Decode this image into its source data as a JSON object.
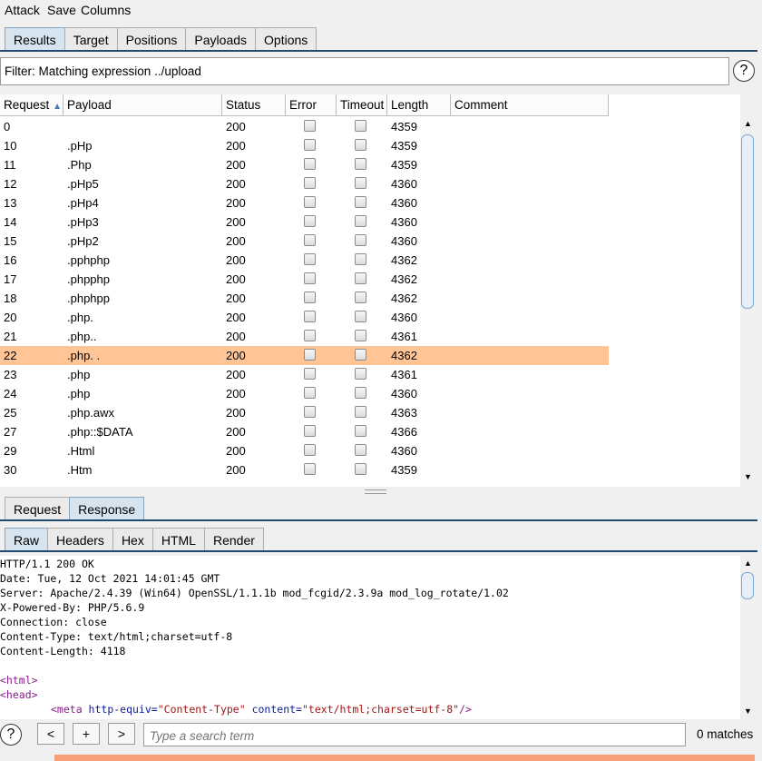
{
  "menu": [
    "Attack",
    "Save",
    "Columns"
  ],
  "tabs": [
    "Results",
    "Target",
    "Positions",
    "Payloads",
    "Options"
  ],
  "filter": {
    "text": "Filter: Matching expression ../upload"
  },
  "table": {
    "headers": [
      "Request",
      "Payload",
      "Status",
      "Error",
      "Timeout",
      "Length",
      "Comment"
    ],
    "sort_indicator": "▲",
    "rows": [
      {
        "request": "0",
        "payload": "",
        "status": "200",
        "length": "4359"
      },
      {
        "request": "10",
        "payload": ".pHp",
        "status": "200",
        "length": "4359"
      },
      {
        "request": "11",
        "payload": ".Php",
        "status": "200",
        "length": "4359"
      },
      {
        "request": "12",
        "payload": ".pHp5",
        "status": "200",
        "length": "4360"
      },
      {
        "request": "13",
        "payload": ".pHp4",
        "status": "200",
        "length": "4360"
      },
      {
        "request": "14",
        "payload": ".pHp3",
        "status": "200",
        "length": "4360"
      },
      {
        "request": "15",
        "payload": ".pHp2",
        "status": "200",
        "length": "4360"
      },
      {
        "request": "16",
        "payload": ".pphphp",
        "status": "200",
        "length": "4362"
      },
      {
        "request": "17",
        "payload": ".phpphp",
        "status": "200",
        "length": "4362"
      },
      {
        "request": "18",
        "payload": ".phphpp",
        "status": "200",
        "length": "4362"
      },
      {
        "request": "20",
        "payload": ".php.",
        "status": "200",
        "length": "4360"
      },
      {
        "request": "21",
        "payload": ".php..",
        "status": "200",
        "length": "4361"
      },
      {
        "request": "22",
        "payload": ".php. .",
        "status": "200",
        "length": "4362",
        "selected": true
      },
      {
        "request": "23",
        "payload": ".php",
        "status": "200",
        "length": "4361"
      },
      {
        "request": "24",
        "payload": ".php",
        "status": "200",
        "length": "4360"
      },
      {
        "request": "25",
        "payload": ".php.awx",
        "status": "200",
        "length": "4363"
      },
      {
        "request": "27",
        "payload": ".php::$DATA",
        "status": "200",
        "length": "4366"
      },
      {
        "request": "29",
        "payload": ".Html",
        "status": "200",
        "length": "4360"
      },
      {
        "request": "30",
        "payload": ".Htm",
        "status": "200",
        "length": "4359"
      }
    ]
  },
  "req_resp_tabs": [
    "Request",
    "Response"
  ],
  "view_tabs": [
    "Raw",
    "Headers",
    "Hex",
    "HTML",
    "Render"
  ],
  "response_lines": [
    "HTTP/1.1 200 OK",
    "Date: Tue, 12 Oct 2021 14:01:45 GMT",
    "Server: Apache/2.4.39 (Win64) OpenSSL/1.1.1b mod_fcgid/2.3.9a mod_log_rotate/1.02",
    "X-Powered-By: PHP/5.6.9",
    "Connection: close",
    "Content-Type: text/html;charset=utf-8",
    "Content-Length: 4118"
  ],
  "html_lines": {
    "html": "<html>",
    "head": "<head>",
    "meta_open": "<meta ",
    "meta_attr1": "http-equiv=",
    "meta_val1": "\"Content-Type\"",
    "meta_attr2": " content=",
    "meta_val2": "\"text/html;charset=utf-8\"",
    "meta_close": "/>"
  },
  "search": {
    "prev": "<",
    "add": "+",
    "next": ">",
    "placeholder": "Type a search term",
    "matches": "0 matches"
  },
  "help_glyph": "?",
  "colors": {
    "selected_row": "#ffc597",
    "tab_active": "#d6e4ef",
    "divider": "#224a6e"
  }
}
